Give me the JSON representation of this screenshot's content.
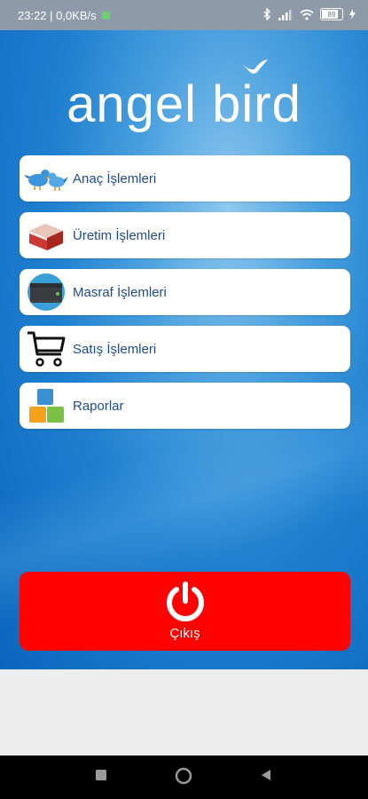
{
  "status_bar": {
    "time_data": "23:22 | 0,0KB/s",
    "battery": "89"
  },
  "logo": {
    "text": "angel bird"
  },
  "menu": {
    "items": [
      {
        "label": "Anaç İşlemleri",
        "icon": "birds-icon"
      },
      {
        "label": "Üretim İşlemleri",
        "icon": "egg-box-icon"
      },
      {
        "label": "Masraf İşlemleri",
        "icon": "wallet-icon"
      },
      {
        "label": "Satış İşlemleri",
        "icon": "shopping-cart-icon"
      },
      {
        "label": "Raporlar",
        "icon": "blocks-icon"
      }
    ]
  },
  "exit": {
    "label": "Çıkış",
    "icon": "power-icon"
  },
  "colors": {
    "exit_red": "#fe0100",
    "menu_text": "#1f4b8e"
  }
}
